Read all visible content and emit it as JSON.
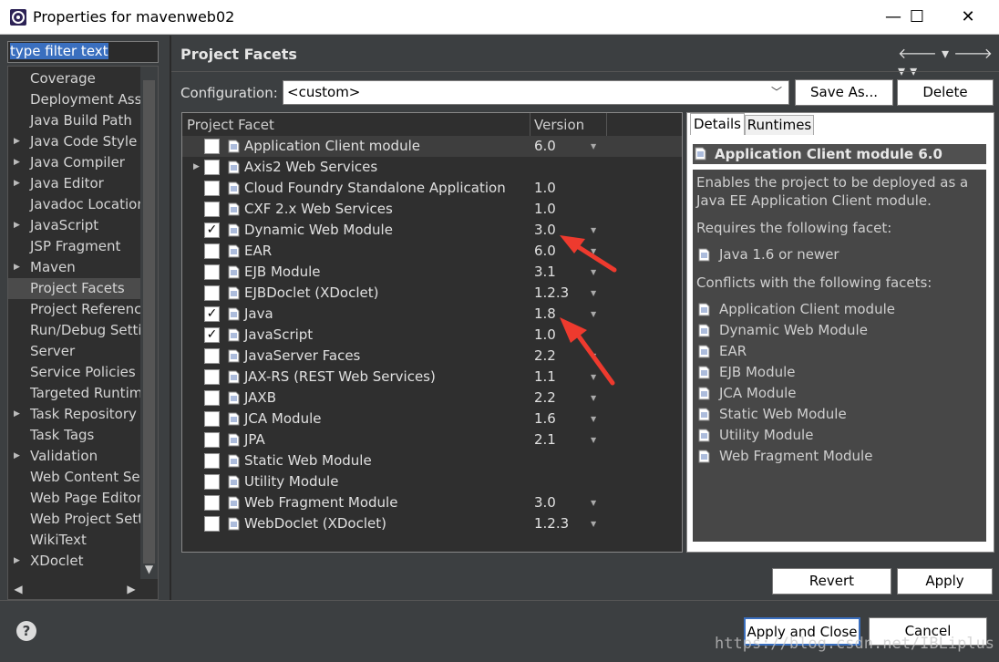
{
  "window": {
    "title": "Properties for mavenweb02",
    "minimize": "—",
    "maximize": "☐",
    "close": "✕"
  },
  "filter": {
    "placeholder": "type filter text"
  },
  "tree": {
    "items": [
      {
        "label": "Coverage",
        "expandable": false
      },
      {
        "label": "Deployment Assembly",
        "expandable": false
      },
      {
        "label": "Java Build Path",
        "expandable": false
      },
      {
        "label": "Java Code Style",
        "expandable": true
      },
      {
        "label": "Java Compiler",
        "expandable": true
      },
      {
        "label": "Java Editor",
        "expandable": true
      },
      {
        "label": "Javadoc Location",
        "expandable": false
      },
      {
        "label": "JavaScript",
        "expandable": true
      },
      {
        "label": "JSP Fragment",
        "expandable": false
      },
      {
        "label": "Maven",
        "expandable": true
      },
      {
        "label": "Project Facets",
        "expandable": false,
        "selected": true
      },
      {
        "label": "Project References",
        "expandable": false
      },
      {
        "label": "Run/Debug Settings",
        "expandable": false
      },
      {
        "label": "Server",
        "expandable": false
      },
      {
        "label": "Service Policies",
        "expandable": false
      },
      {
        "label": "Targeted Runtimes",
        "expandable": false
      },
      {
        "label": "Task Repository",
        "expandable": true
      },
      {
        "label": "Task Tags",
        "expandable": false
      },
      {
        "label": "Validation",
        "expandable": true
      },
      {
        "label": "Web Content Settings",
        "expandable": false
      },
      {
        "label": "Web Page Editor",
        "expandable": false
      },
      {
        "label": "Web Project Settings",
        "expandable": false
      },
      {
        "label": "WikiText",
        "expandable": false
      },
      {
        "label": "XDoclet",
        "expandable": true
      }
    ]
  },
  "page": {
    "title": "Project Facets",
    "nav_back": "🡐 ▾",
    "nav_forward": "🡒 ▾ ▾"
  },
  "config": {
    "label": "Configuration:",
    "value": "<custom>",
    "save_as": "Save As...",
    "delete": "Delete"
  },
  "table": {
    "header_facet": "Project Facet",
    "header_version": "Version",
    "rows": [
      {
        "name": "Application Client module",
        "version": "6.0",
        "checked": false,
        "dropdown": true,
        "highlight": true,
        "expandable": false
      },
      {
        "name": "Axis2 Web Services",
        "version": "",
        "checked": false,
        "dropdown": false,
        "expandable": true
      },
      {
        "name": "Cloud Foundry Standalone Application",
        "version": "1.0",
        "checked": false,
        "dropdown": false
      },
      {
        "name": "CXF 2.x Web Services",
        "version": "1.0",
        "checked": false,
        "dropdown": false
      },
      {
        "name": "Dynamic Web Module",
        "version": "3.0",
        "checked": true,
        "dropdown": true
      },
      {
        "name": "EAR",
        "version": "6.0",
        "checked": false,
        "dropdown": true
      },
      {
        "name": "EJB Module",
        "version": "3.1",
        "checked": false,
        "dropdown": true
      },
      {
        "name": "EJBDoclet (XDoclet)",
        "version": "1.2.3",
        "checked": false,
        "dropdown": true
      },
      {
        "name": "Java",
        "version": "1.8",
        "checked": true,
        "dropdown": true
      },
      {
        "name": "JavaScript",
        "version": "1.0",
        "checked": true,
        "dropdown": false
      },
      {
        "name": "JavaServer Faces",
        "version": "2.2",
        "checked": false,
        "dropdown": true
      },
      {
        "name": "JAX-RS (REST Web Services)",
        "version": "1.1",
        "checked": false,
        "dropdown": true
      },
      {
        "name": "JAXB",
        "version": "2.2",
        "checked": false,
        "dropdown": true
      },
      {
        "name": "JCA Module",
        "version": "1.6",
        "checked": false,
        "dropdown": true
      },
      {
        "name": "JPA",
        "version": "2.1",
        "checked": false,
        "dropdown": true
      },
      {
        "name": "Static Web Module",
        "version": "",
        "checked": false,
        "dropdown": false
      },
      {
        "name": "Utility Module",
        "version": "",
        "checked": false,
        "dropdown": false
      },
      {
        "name": "Web Fragment Module",
        "version": "3.0",
        "checked": false,
        "dropdown": true
      },
      {
        "name": "WebDoclet (XDoclet)",
        "version": "1.2.3",
        "checked": false,
        "dropdown": true
      }
    ]
  },
  "details": {
    "tab_details": "Details",
    "tab_runtimes": "Runtimes",
    "header": "Application Client module 6.0",
    "desc_line1": "Enables the project to be deployed as a",
    "desc_line2": "Java EE Application Client module.",
    "requires_label": "Requires the following facet:",
    "requires": [
      "Java 1.6 or newer"
    ],
    "conflicts_label": "Conflicts with the following facets:",
    "conflicts": [
      "Application Client module",
      "Dynamic Web Module",
      "EAR",
      "EJB Module",
      "JCA Module",
      "Static Web Module",
      "Utility Module",
      "Web Fragment Module"
    ]
  },
  "buttons": {
    "revert": "Revert",
    "apply": "Apply",
    "apply_close": "Apply and Close",
    "cancel": "Cancel",
    "help": "?"
  },
  "watermark": "https://blog.csdn.net/IBLiplus",
  "colors": {
    "background": "#3c3f41",
    "selection": "#3a6fbf",
    "annotation_arrow": "#ee3a2e"
  }
}
